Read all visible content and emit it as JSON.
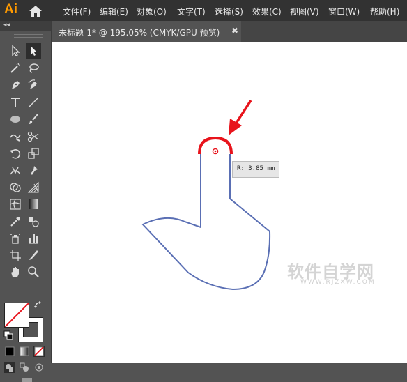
{
  "app": {
    "logo": "Ai"
  },
  "menu": [
    "文件(F)",
    "编辑(E)",
    "对象(O)",
    "文字(T)",
    "选择(S)",
    "效果(C)",
    "视图(V)",
    "窗口(W)",
    "帮助(H)"
  ],
  "toolpanel": {
    "collapse_label": "◂◂"
  },
  "document": {
    "tab_title": "未标题-1* @ 195.05% (CMYK/GPU 预览)",
    "close_glyph": "✖"
  },
  "canvas": {
    "tooltip": "R: 3.85 mm",
    "shape_stroke_color": "#5a6fb4",
    "highlight_color": "#e8141c",
    "arrow_color": "#e8141c"
  },
  "watermark": {
    "text": "软件自学网",
    "sub": "WWW.RJZXW.COM"
  },
  "icons": [
    "selection-tool",
    "direct-selection-tool",
    "magic-wand-tool",
    "lasso-tool",
    "pen-tool",
    "curvature-tool",
    "type-tool",
    "line-segment-tool",
    "ellipse-tool",
    "paintbrush-tool",
    "shaper-tool",
    "scissors-tool",
    "rotate-tool",
    "scale-tool",
    "width-tool",
    "puppet-warp-tool",
    "shape-builder-tool",
    "perspective-grid-tool",
    "mesh-tool",
    "gradient-tool",
    "eyedropper-tool",
    "blend-tool",
    "symbol-sprayer-tool",
    "column-graph-tool",
    "artboard-tool",
    "slice-tool",
    "hand-tool",
    "zoom-tool"
  ]
}
